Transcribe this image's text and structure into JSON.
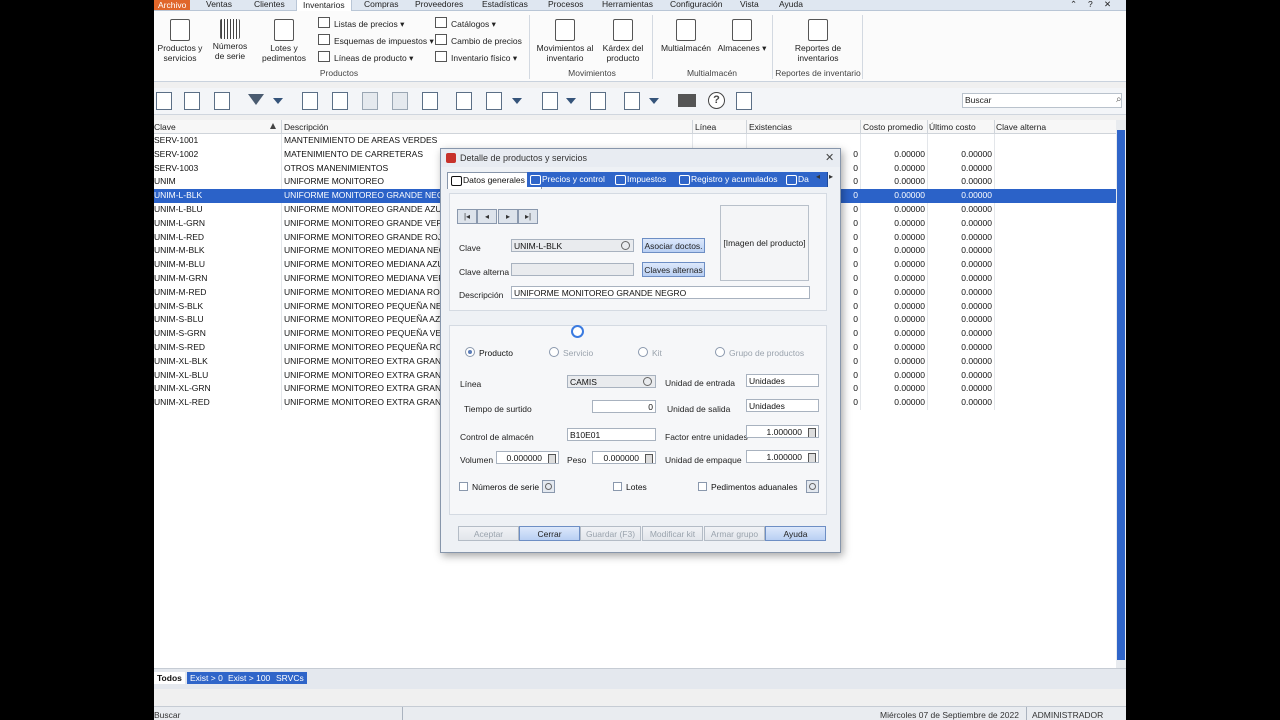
{
  "menu": {
    "items": [
      "Archivo",
      "Ventas",
      "Clientes",
      "Inventarios",
      "Compras",
      "Proveedores",
      "Estadísticas",
      "Procesos",
      "Herramientas",
      "Configuración",
      "Vista",
      "Ayuda"
    ]
  },
  "ribbon": {
    "productos_servicios": "Productos y servicios",
    "numeros_serie": "Números de serie",
    "lotes_pedimentos": "Lotes y pedimentos",
    "listas_precios": "Listas de precios",
    "esquemas_impuestos": "Esquemas de impuestos",
    "lineas_producto": "Líneas de producto",
    "catalogos": "Catálogos",
    "cambio_precios": "Cambio de precios",
    "inventario_fisico": "Inventario físico",
    "group_productos": "Productos",
    "movimientos_inventario": "Movimientos al inventario",
    "kardex_producto": "Kárdex del producto",
    "group_movimientos": "Movimientos",
    "multialmacen": "Multialmacén",
    "almacenes": "Almacenes",
    "group_multialmacen": "Multialmacén",
    "reportes_inventarios": "Reportes de inventarios",
    "group_reportes": "Reportes de inventario"
  },
  "search": {
    "placeholder": "Buscar"
  },
  "grid": {
    "columns": [
      "Clave",
      "Descripción",
      "Línea",
      "Existencias",
      "Costo promedio",
      "Último costo",
      "Clave alterna"
    ],
    "rows": [
      {
        "clave": "SERV-1001",
        "desc": "MANTENIMIENTO DE AREAS VERDES",
        "exist": "",
        "costo": "",
        "ultimo": ""
      },
      {
        "clave": "SERV-1002",
        "desc": "MATENIMIENTO DE CARRETERAS",
        "exist": "0",
        "costo": "0.00000",
        "ultimo": "0.00000"
      },
      {
        "clave": "SERV-1003",
        "desc": "OTROS MANENIMIENTOS",
        "exist": "0",
        "costo": "0.00000",
        "ultimo": "0.00000"
      },
      {
        "clave": "UNIM",
        "desc": "UNIFORME MONITOREO",
        "exist": "0",
        "costo": "0.00000",
        "ultimo": "0.00000"
      },
      {
        "clave": "UNIM-L-BLK",
        "desc": "UNIFORME MONITOREO GRANDE NEGRO",
        "exist": "0",
        "costo": "0.00000",
        "ultimo": "0.00000"
      },
      {
        "clave": "UNIM-L-BLU",
        "desc": "UNIFORME MONITOREO GRANDE AZUL",
        "exist": "0",
        "costo": "0.00000",
        "ultimo": "0.00000"
      },
      {
        "clave": "UNIM-L-GRN",
        "desc": "UNIFORME MONITOREO GRANDE VERDE",
        "exist": "0",
        "costo": "0.00000",
        "ultimo": "0.00000"
      },
      {
        "clave": "UNIM-L-RED",
        "desc": "UNIFORME MONITOREO GRANDE ROJO",
        "exist": "0",
        "costo": "0.00000",
        "ultimo": "0.00000"
      },
      {
        "clave": "UNIM-M-BLK",
        "desc": "UNIFORME MONITOREO MEDIANA NEGRO",
        "exist": "0",
        "costo": "0.00000",
        "ultimo": "0.00000"
      },
      {
        "clave": "UNIM-M-BLU",
        "desc": "UNIFORME MONITOREO MEDIANA AZUL",
        "exist": "0",
        "costo": "0.00000",
        "ultimo": "0.00000"
      },
      {
        "clave": "UNIM-M-GRN",
        "desc": "UNIFORME MONITOREO MEDIANA VERDE",
        "exist": "0",
        "costo": "0.00000",
        "ultimo": "0.00000"
      },
      {
        "clave": "UNIM-M-RED",
        "desc": "UNIFORME MONITOREO MEDIANA ROJO",
        "exist": "0",
        "costo": "0.00000",
        "ultimo": "0.00000"
      },
      {
        "clave": "UNIM-S-BLK",
        "desc": "UNIFORME MONITOREO PEQUEÑA NEGRO",
        "exist": "0",
        "costo": "0.00000",
        "ultimo": "0.00000"
      },
      {
        "clave": "UNIM-S-BLU",
        "desc": "UNIFORME MONITOREO PEQUEÑA AZUL",
        "exist": "0",
        "costo": "0.00000",
        "ultimo": "0.00000"
      },
      {
        "clave": "UNIM-S-GRN",
        "desc": "UNIFORME MONITOREO PEQUEÑA VERDE",
        "exist": "0",
        "costo": "0.00000",
        "ultimo": "0.00000"
      },
      {
        "clave": "UNIM-S-RED",
        "desc": "UNIFORME MONITOREO PEQUEÑA ROJO",
        "exist": "0",
        "costo": "0.00000",
        "ultimo": "0.00000"
      },
      {
        "clave": "UNIM-XL-BLK",
        "desc": "UNIFORME MONITOREO EXTRA GRANDE NEGRO",
        "exist": "0",
        "costo": "0.00000",
        "ultimo": "0.00000"
      },
      {
        "clave": "UNIM-XL-BLU",
        "desc": "UNIFORME MONITOREO EXTRA GRANDE AZUL",
        "exist": "0",
        "costo": "0.00000",
        "ultimo": "0.00000"
      },
      {
        "clave": "UNIM-XL-GRN",
        "desc": "UNIFORME MONITOREO EXTRA GRANDE VERDE",
        "exist": "0",
        "costo": "0.00000",
        "ultimo": "0.00000"
      },
      {
        "clave": "UNIM-XL-RED",
        "desc": "UNIFORME MONITOREO EXTRA GRANDE ROJO",
        "exist": "0",
        "costo": "0.00000",
        "ultimo": "0.00000"
      }
    ],
    "selected_index": 4
  },
  "footer_tabs": [
    "Todos",
    "Exist > 0",
    "Exist > 100",
    "SRVCs"
  ],
  "status": {
    "search_label": "Buscar",
    "date": "Miércoles 07 de Septiembre de 2022",
    "user": "ADMINISTRADOR"
  },
  "dialog": {
    "title": "Detalle de productos y servicios",
    "tabs": [
      "Datos generales",
      "Precios y control",
      "Impuestos",
      "Registro y acumulados",
      "Da"
    ],
    "clave_label": "Clave",
    "clave_value": "UNIM-L-BLK",
    "clave_alterna_label": "Clave alterna",
    "clave_alterna_value": "",
    "descripcion_label": "Descripción",
    "descripcion_value": "UNIFORME MONITOREO GRANDE NEGRO",
    "asociar_btn": "Asociar doctos.",
    "claves_alternas_btn": "Claves alternas",
    "imagen_label": "[Imagen del producto]",
    "tipo": [
      "Producto",
      "Servicio",
      "Kit",
      "Grupo de productos"
    ],
    "linea_label": "Línea",
    "linea_value": "CAMIS",
    "tiempo_surtido_label": "Tiempo de surtido",
    "tiempo_surtido_value": "0",
    "control_almacen_label": "Control de almacén",
    "control_almacen_value": "B10E01",
    "volumen_label": "Volumen",
    "volumen_value": "0.000000",
    "peso_label": "Peso",
    "peso_value": "0.000000",
    "unidad_entrada_label": "Unidad de entrada",
    "unidad_entrada_value": "Unidades",
    "unidad_salida_label": "Unidad de salida",
    "unidad_salida_value": "Unidades",
    "factor_label": "Factor entre unidades",
    "factor_value": "1.000000",
    "unidad_empaque_label": "Unidad de empaque",
    "unidad_empaque_value": "1.000000",
    "numeros_serie_chk": "Números de serie",
    "lotes_chk": "Lotes",
    "pedimentos_chk": "Pedimentos aduanales",
    "buttons": [
      "Aceptar",
      "Cerrar",
      "Guardar (F3)",
      "Modificar kit",
      "Armar grupo",
      "Ayuda"
    ]
  },
  "colors": {
    "accent": "#2f65c9",
    "selection": "#2b62c8",
    "archivo": "#e0662a"
  }
}
